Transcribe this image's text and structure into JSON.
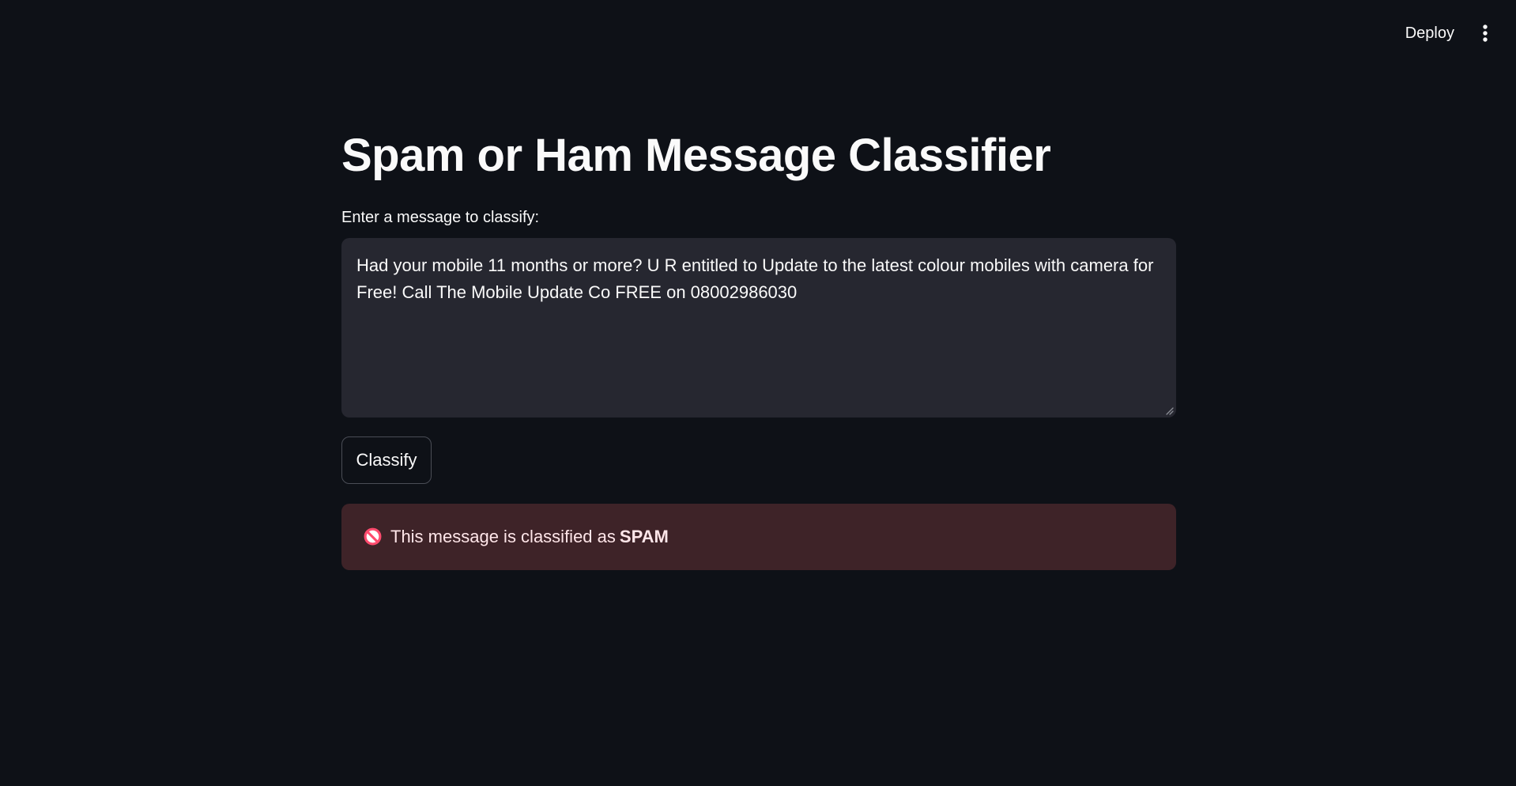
{
  "toolbar": {
    "deploy_label": "Deploy",
    "menu_icon": "more-vertical-icon"
  },
  "page": {
    "title": "Spam or Ham Message Classifier"
  },
  "input": {
    "label": "Enter a message to classify:",
    "value": "Had your mobile 11 months or more? U R entitled to Update to the latest colour mobiles with camera for Free! Call The Mobile Update Co FREE on 08002986030"
  },
  "actions": {
    "classify_label": "Classify"
  },
  "result": {
    "icon": "prohibited-icon",
    "prefix": "This message is classified as",
    "classification": "SPAM"
  },
  "colors": {
    "background": "#0e1117",
    "input_background": "#262730",
    "error_background": "#3e2328",
    "error_icon": "#ff4b6e"
  }
}
